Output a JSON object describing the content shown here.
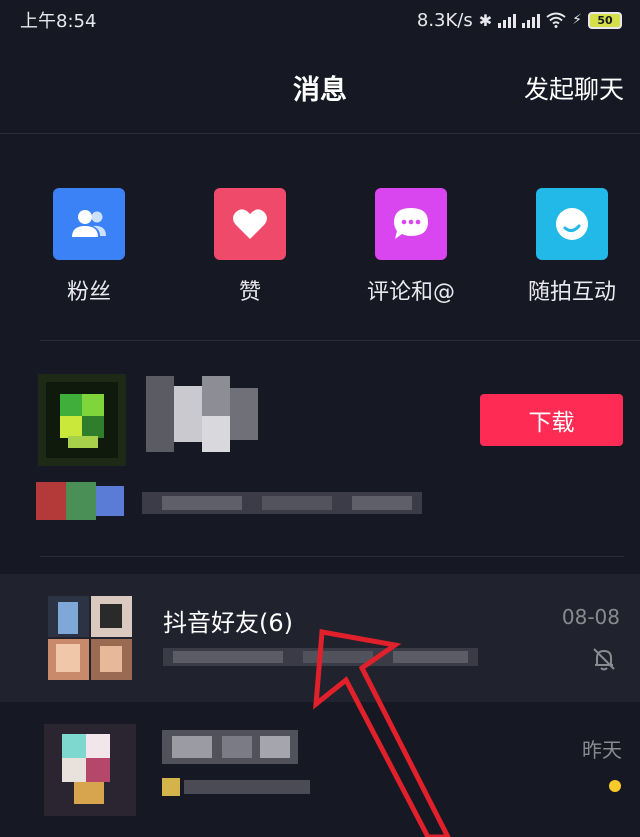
{
  "status_bar": {
    "time": "上午8:54",
    "network_speed": "8.3K/s",
    "battery_level": "50"
  },
  "header": {
    "title": "消息",
    "action_label": "发起聊天"
  },
  "shortcuts": [
    {
      "label": "粉丝",
      "icon": "users-icon",
      "color": "#3b82f6"
    },
    {
      "label": "赞",
      "icon": "heart-icon",
      "color": "#f04a6a"
    },
    {
      "label": "评论和@",
      "icon": "chat-bubble-icon",
      "color": "#d946ef"
    },
    {
      "label": "随拍互动",
      "icon": "camera-circle-icon",
      "color": "#22b8e8"
    }
  ],
  "promo": {
    "download_label": "下载"
  },
  "conversations": [
    {
      "title": "抖音好友(6)",
      "time": "08-08",
      "muted": true
    },
    {
      "time": "昨天",
      "unread": true
    }
  ],
  "colors": {
    "background": "#161823",
    "accent": "#fe2c55",
    "unread_dot": "#f9c929",
    "annotation_arrow": "#e0202a"
  }
}
